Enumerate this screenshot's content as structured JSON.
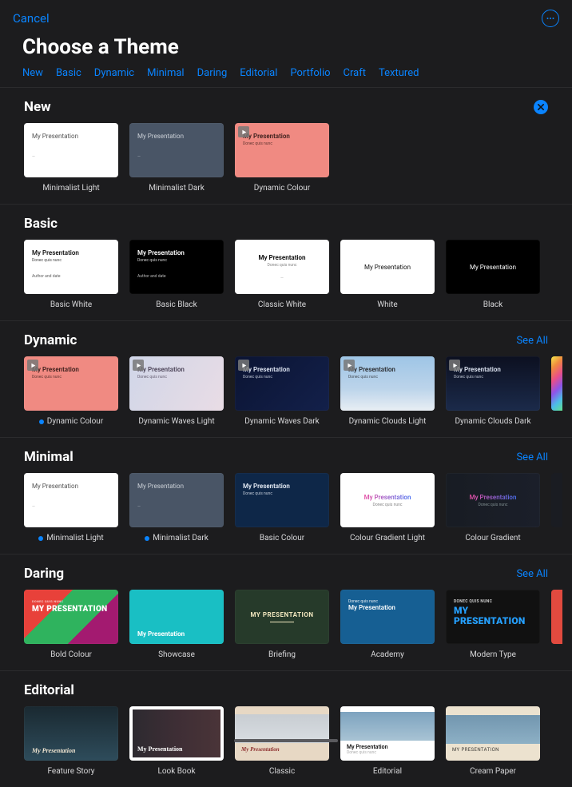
{
  "header": {
    "cancel": "Cancel",
    "title": "Choose a Theme"
  },
  "tabs": [
    "New",
    "Basic",
    "Dynamic",
    "Minimal",
    "Daring",
    "Editorial",
    "Portfolio",
    "Craft",
    "Textured"
  ],
  "slideTitle": "My Presentation",
  "slideTitleCaps": "MY PRESENTATION",
  "slideSubtitle": "Donec quis nunc",
  "seeAll": "See All",
  "sections": {
    "new": {
      "title": "New",
      "items": [
        {
          "label": "Minimalist Light"
        },
        {
          "label": "Minimalist Dark"
        },
        {
          "label": "Dynamic Colour"
        }
      ]
    },
    "basic": {
      "title": "Basic",
      "items": [
        {
          "label": "Basic White"
        },
        {
          "label": "Basic Black"
        },
        {
          "label": "Classic White"
        },
        {
          "label": "White"
        },
        {
          "label": "Black"
        }
      ]
    },
    "dynamic": {
      "title": "Dynamic",
      "items": [
        {
          "label": "Dynamic Colour"
        },
        {
          "label": "Dynamic Waves Light"
        },
        {
          "label": "Dynamic Waves Dark"
        },
        {
          "label": "Dynamic Clouds Light"
        },
        {
          "label": "Dynamic Clouds Dark"
        }
      ]
    },
    "minimal": {
      "title": "Minimal",
      "items": [
        {
          "label": "Minimalist Light"
        },
        {
          "label": "Minimalist Dark"
        },
        {
          "label": "Basic Colour"
        },
        {
          "label": "Colour Gradient Light"
        },
        {
          "label": "Colour Gradient"
        }
      ]
    },
    "daring": {
      "title": "Daring",
      "items": [
        {
          "label": "Bold Colour"
        },
        {
          "label": "Showcase"
        },
        {
          "label": "Briefing"
        },
        {
          "label": "Academy"
        },
        {
          "label": "Modern Type"
        }
      ]
    },
    "editorial": {
      "title": "Editorial",
      "items": [
        {
          "label": "Feature Story"
        },
        {
          "label": "Look Book"
        },
        {
          "label": "Classic"
        },
        {
          "label": "Editorial"
        },
        {
          "label": "Cream Paper"
        }
      ]
    }
  }
}
